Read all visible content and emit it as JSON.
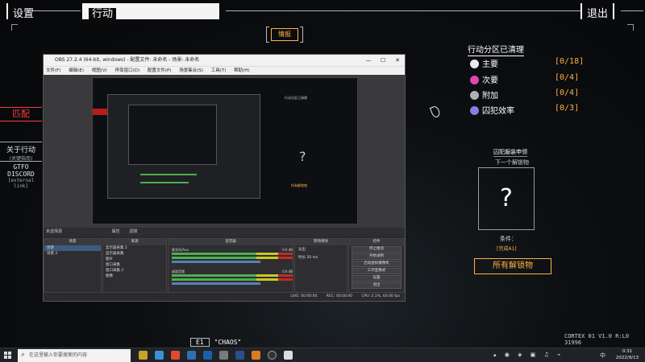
{
  "game": {
    "tabs": {
      "settings": "设置",
      "action": "行动",
      "exit": "退出"
    },
    "intel_button": "情报",
    "left": {
      "match": "匹配",
      "about": "关于行动",
      "about_sub": "(关键指南)",
      "discord": "GTFO DISCORD",
      "discord_sub": "[external link]"
    },
    "objectives": {
      "title": "行动分区已清理",
      "items": [
        {
          "label": "主要",
          "value": "[0/18]",
          "color": "#e9e9e9"
        },
        {
          "label": "次要",
          "value": "[0/4]",
          "color": "#d94ab0"
        },
        {
          "label": "附加",
          "value": "[0/4]",
          "color": "#b0b0b0"
        },
        {
          "label": "囚犯效率",
          "value": "[0/3]",
          "color": "#8a7de0"
        }
      ]
    },
    "artifact": {
      "title": "囚犯服装申领",
      "subtitle": "下一个解锁物",
      "unknown": "?",
      "condition": "条件：",
      "condition_value": "[完成A1]",
      "all_button": "所有解锁物"
    },
    "expedition_code": "E1",
    "expedition_name": "\"CHAOS\"",
    "version": "CORTEX 01 V1.0 R:L0 31996"
  },
  "obs": {
    "title": "OBS 27.2.4 (64-bit, windows) - 配置文件: 未命名 - 场景: 未命名",
    "window_buttons": [
      "—",
      "☐",
      "✕"
    ],
    "menu": [
      "文件(F)",
      "编辑(E)",
      "视图(V)",
      "停靠窗口(D)",
      "配置文件(P)",
      "场景集合(S)",
      "工具(T)",
      "帮助(H)"
    ],
    "source_bar": [
      "未选择源",
      "属性",
      "滤镜"
    ],
    "docks": {
      "scenes": {
        "title": "场景",
        "items": [
          "场景",
          "场景 2"
        ]
      },
      "sources": {
        "title": "来源",
        "items": [
          "显示器采集 2",
          "显示器采集",
          "图片",
          "窗口采集",
          "窗口采集 2",
          "图像"
        ]
      },
      "mixer": {
        "title": "混音器",
        "channels": [
          {
            "name": "麦克风/Aux",
            "db": "0.0 dB"
          },
          {
            "name": "桌面音频",
            "db": "0.0 dB"
          }
        ]
      },
      "transitions": {
        "title": "转场特效",
        "type": "淡出",
        "duration_label": "时长",
        "duration": "50 ms"
      },
      "controls": {
        "title": "控件",
        "buttons": [
          "停止推流",
          "开始录制",
          "启动虚拟摄像机",
          "工作室模式",
          "设置",
          "退出"
        ]
      }
    },
    "status": [
      "LIVE: 00:00:00",
      "REC: 00:00:00",
      "CPU: 2.1%, 60.00 fps"
    ]
  },
  "taskbar": {
    "search_placeholder": "在这里输入你要搜索的内容",
    "language": "中",
    "time": "0:31",
    "date": "2022/9/13"
  }
}
